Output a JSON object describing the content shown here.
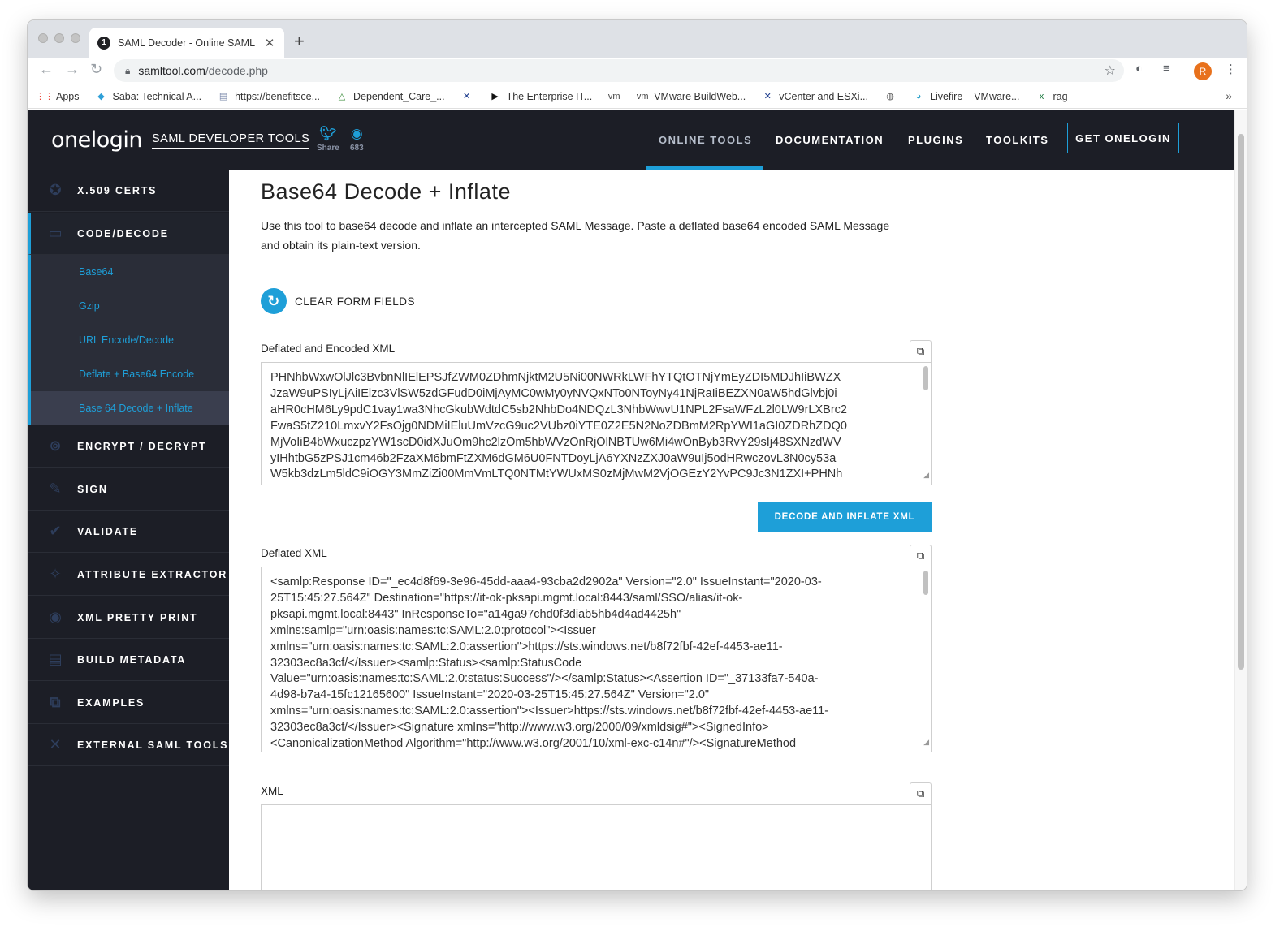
{
  "browser": {
    "tab_title": "SAML Decoder - Online SAML",
    "tab_favicon": "1",
    "url_host": "samltool.com",
    "url_path": "/decode.php",
    "avatar_letter": "R",
    "bookmarks": [
      {
        "label": "Apps",
        "icon": "apps-grid-icon",
        "glyph": "⋮⋮",
        "color": "#ea4335"
      },
      {
        "label": "Saba: Technical A...",
        "icon": "saba-icon",
        "glyph": "◆",
        "color": "#2fa0d8"
      },
      {
        "label": "https://benefitsce...",
        "icon": "page-icon",
        "glyph": "▤",
        "color": "#7a88aa"
      },
      {
        "label": "Dependent_Care_...",
        "icon": "drive-icon",
        "glyph": "△",
        "color": "#3a8c3a"
      },
      {
        "label": "",
        "icon": "x-tools-icon",
        "glyph": "✕",
        "color": "#1b3a8c"
      },
      {
        "label": "The Enterprise IT...",
        "icon": "play-icon",
        "glyph": "▶",
        "color": "#111111"
      },
      {
        "label": "",
        "icon": "vm-icon",
        "glyph": "vm",
        "color": "#444444"
      },
      {
        "label": "VMware BuildWeb...",
        "icon": "vm-icon",
        "glyph": "vm",
        "color": "#444444"
      },
      {
        "label": "vCenter and ESXi...",
        "icon": "x-tools-icon",
        "glyph": "✕",
        "color": "#1b3a8c"
      },
      {
        "label": "",
        "icon": "globe-icon",
        "glyph": "◍",
        "color": "#555555"
      },
      {
        "label": "Livefire – VMware...",
        "icon": "livefire-icon",
        "glyph": "◕",
        "color": "#2aa0c9"
      },
      {
        "label": "rag",
        "icon": "excel-icon",
        "glyph": "x",
        "color": "#1d7a40"
      }
    ],
    "bookmarks_more": "»"
  },
  "header": {
    "logo": "onelogin",
    "subtitle": "SAML DEVELOPER TOOLS",
    "twitter_label": "Share",
    "github_count": "683",
    "nav": [
      "ONLINE TOOLS",
      "DOCUMENTATION",
      "PLUGINS",
      "TOOLKITS"
    ],
    "cta": "GET ONELOGIN",
    "accent": "#1e9fd8",
    "bg": "#1c1e26"
  },
  "sidebar": {
    "items": [
      {
        "label": "X.509 CERTS",
        "icon": "certificate-icon"
      },
      {
        "label": "CODE/DECODE",
        "icon": "code-decode-icon"
      },
      {
        "label": "ENCRYPT / DECRYPT",
        "icon": "lock-icon"
      },
      {
        "label": "SIGN",
        "icon": "sign-icon"
      },
      {
        "label": "VALIDATE",
        "icon": "thumbs-up-icon"
      },
      {
        "label": "ATTRIBUTE EXTRACTOR",
        "icon": "magic-wand-icon"
      },
      {
        "label": "XML PRETTY PRINT",
        "icon": "eye-icon"
      },
      {
        "label": "BUILD METADATA",
        "icon": "metadata-icon"
      },
      {
        "label": "EXAMPLES",
        "icon": "code-window-icon"
      },
      {
        "label": "EXTERNAL SAML TOOLS",
        "icon": "tools-icon"
      }
    ],
    "subitems": [
      "Base64",
      "Gzip",
      "URL Encode/Decode",
      "Deflate + Base64 Encode",
      "Base 64 Decode + Inflate"
    ]
  },
  "main": {
    "title": "Base64 Decode + Inflate",
    "intro": "Use this tool to base64 decode and inflate an intercepted SAML Message. Paste a deflated base64 encoded SAML Message and obtain its plain-text version.",
    "clear_label": "CLEAR FORM FIELDS",
    "field1_label": "Deflated and Encoded XML",
    "field1_lines": [
      "PHNhbWxwOlJlc3BvbnNlIElEPSJfZWM0ZDhmNjktM2U5Ni00NWRkLWFhYTQtOTNjYmEyZDI5MDJhIiBWZX",
      "JzaW9uPSIyLjAiIElzc3VlSW5zdGFudD0iMjAyMC0wMy0yNVQxNTo0NToyNy41NjRaIiBEZXN0aW5hdGlvbj0i",
      "aHR0cHM6Ly9pdC1vay1wa3NhcGkubWdtdC5sb2NhbDo4NDQzL3NhbWwvU1NPL2FsaWFzL2l0LW9rLXBrc2",
      "FwaS5tZ210LmxvY2FsOjg0NDMiIEluUmVzcG9uc2VUbz0iYTE0Z2E5N2NoZDBmM2RpYWI1aGI0ZDRhZDQ0",
      "MjVoIiB4bWxuczpzYW1scD0idXJuOm9hc2lzOm5hbWVzOnRjOlNBTUw6Mi4wOnByb3RvY29sIj48SXNzdWV",
      "yIHhtbG5zPSJ1cm46b2FzaXM6bmFtZXM6dGM6U0FNTDoyLjA6YXNzZXJ0aW9uIj5odHRwczovL3N0cy53a",
      "W5kb3dzLm5ldC9iOGY3MmZiZi00MmVmLTQ0NTMtYWUxMS0zMjMwM2VjOGEzY2YvPC9Jc3N1ZXI+PHNh"
    ],
    "decode_button": "DECODE AND INFLATE XML",
    "field2_label": "Deflated XML",
    "field2_lines": [
      "<samlp:Response ID=\"_ec4d8f69-3e96-45dd-aaa4-93cba2d2902a\" Version=\"2.0\" IssueInstant=\"2020-03-",
      "25T15:45:27.564Z\" Destination=\"https://it-ok-pksapi.mgmt.local:8443/saml/SSO/alias/it-ok-",
      "pksapi.mgmt.local:8443\" InResponseTo=\"a14ga97chd0f3diab5hb4d4ad4425h\"",
      "xmlns:samlp=\"urn:oasis:names:tc:SAML:2.0:protocol\"><Issuer",
      "xmlns=\"urn:oasis:names:tc:SAML:2.0:assertion\">https://sts.windows.net/b8f72fbf-42ef-4453-ae11-",
      "32303ec8a3cf/</Issuer><samlp:Status><samlp:StatusCode",
      "Value=\"urn:oasis:names:tc:SAML:2.0:status:Success\"/></samlp:Status><Assertion ID=\"_37133fa7-540a-",
      "4d98-b7a4-15fc12165600\" IssueInstant=\"2020-03-25T15:45:27.564Z\" Version=\"2.0\"",
      "xmlns=\"urn:oasis:names:tc:SAML:2.0:assertion\"><Issuer>https://sts.windows.net/b8f72fbf-42ef-4453-ae11-",
      "32303ec8a3cf/</Issuer><Signature xmlns=\"http://www.w3.org/2000/09/xmldsig#\"><SignedInfo>",
      "<CanonicalizationMethod Algorithm=\"http://www.w3.org/2001/10/xml-exc-c14n#\"/><SignatureMethod"
    ],
    "field3_label": "XML",
    "field3_value": ""
  }
}
